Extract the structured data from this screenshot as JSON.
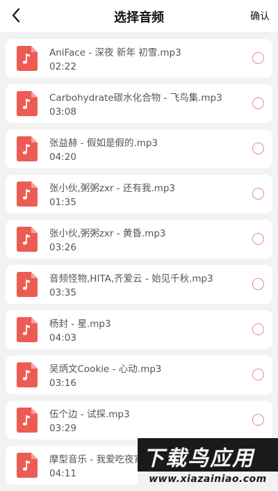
{
  "header": {
    "title": "选择音频",
    "confirm_label": "确认"
  },
  "accent_color": "#ec5c53",
  "radio_color": "#e88a8a",
  "items": [
    {
      "name": "AniFace - 深夜 新年 初雪.mp3",
      "duration": "02:22"
    },
    {
      "name": "Carbohydrate碳水化合物 - 飞鸟集.mp3",
      "duration": "03:08"
    },
    {
      "name": "张益赫 - 假如是假的.mp3",
      "duration": "04:20"
    },
    {
      "name": "张小伙,粥粥zxr - 还有我.mp3",
      "duration": "01:35"
    },
    {
      "name": "张小伙,粥粥zxr - 黄昏.mp3",
      "duration": "03:26"
    },
    {
      "name": "音频怪物,HITA,齐爱云 - 始见千秋.mp3",
      "duration": "03:35"
    },
    {
      "name": "杨封 - 星.mp3",
      "duration": "04:03"
    },
    {
      "name": "吴炳文Cookie - 心动.mp3",
      "duration": "03:16"
    },
    {
      "name": "伍个边 - 试探.mp3",
      "duration": "03:29"
    },
    {
      "name": "摩型音乐 - 我爱吃夜宵",
      "duration": "04:11"
    }
  ],
  "watermark": {
    "title": "下载鸟应用",
    "url": "www.xiazainiao.com"
  }
}
